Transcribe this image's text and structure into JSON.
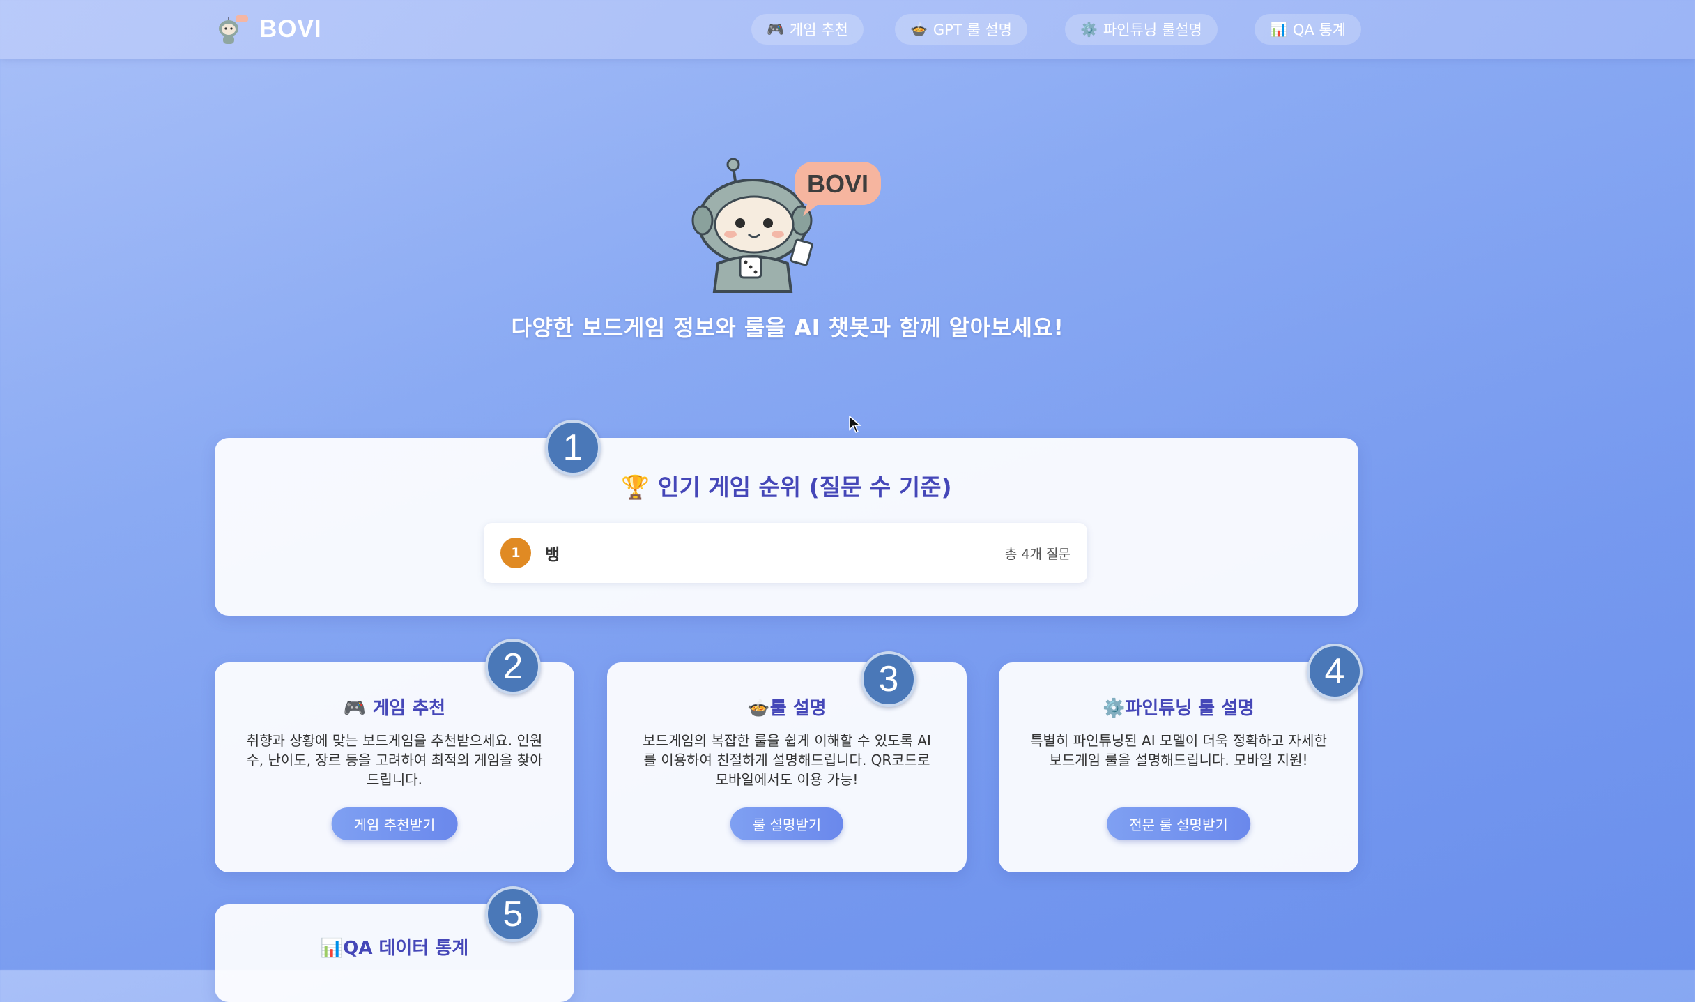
{
  "brand": {
    "name": "BOVI",
    "logo_icon": "robot-mascot-icon"
  },
  "nav": [
    {
      "icon": "🎮",
      "label": "게임 추천"
    },
    {
      "icon": "🍲",
      "label": "GPT 룰 설명"
    },
    {
      "icon": "⚙️",
      "label": "파인튜닝 룰설명"
    },
    {
      "icon": "📊",
      "label": "QA 통계"
    }
  ],
  "hero": {
    "mascot_badge": "BOVI",
    "tagline": "다양한 보드게임 정보와 룰을 AI 챗봇과 함께 알아보세요!"
  },
  "ranking": {
    "title": "🏆 인기 게임 순위 (질문 수 기준)",
    "items": [
      {
        "rank": "1",
        "name": "뱅",
        "count": "총 4개 질문"
      }
    ]
  },
  "features": [
    {
      "title": "🎮 게임 추천",
      "desc": "취향과 상황에 맞는 보드게임을 추천받으세요. 인원수, 난이도, 장르 등을 고려하여 최적의 게임을 찾아드립니다.",
      "button": "게임 추천받기"
    },
    {
      "title": "🍲룰 설명",
      "desc": "보드게임의 복잡한 룰을 쉽게 이해할 수 있도록 AI를 이용하여 친절하게 설명해드립니다. QR코드로 모바일에서도 이용 가능!",
      "button": "룰 설명받기"
    },
    {
      "title": "⚙️파인튜닝 룰 설명",
      "desc": "특별히 파인튜닝된 AI 모델이 더욱 정확하고 자세한 보드게임 룰을 설명해드립니다. 모바일 지원!",
      "button": "전문 룰 설명받기"
    }
  ],
  "stats": {
    "title": "📊QA 데이터 통계"
  },
  "markers": [
    "1",
    "2",
    "3",
    "4",
    "5"
  ],
  "colors": {
    "accent": "#4547b8",
    "rank_badge": "#e08a23",
    "marker": "#4a78b8"
  }
}
